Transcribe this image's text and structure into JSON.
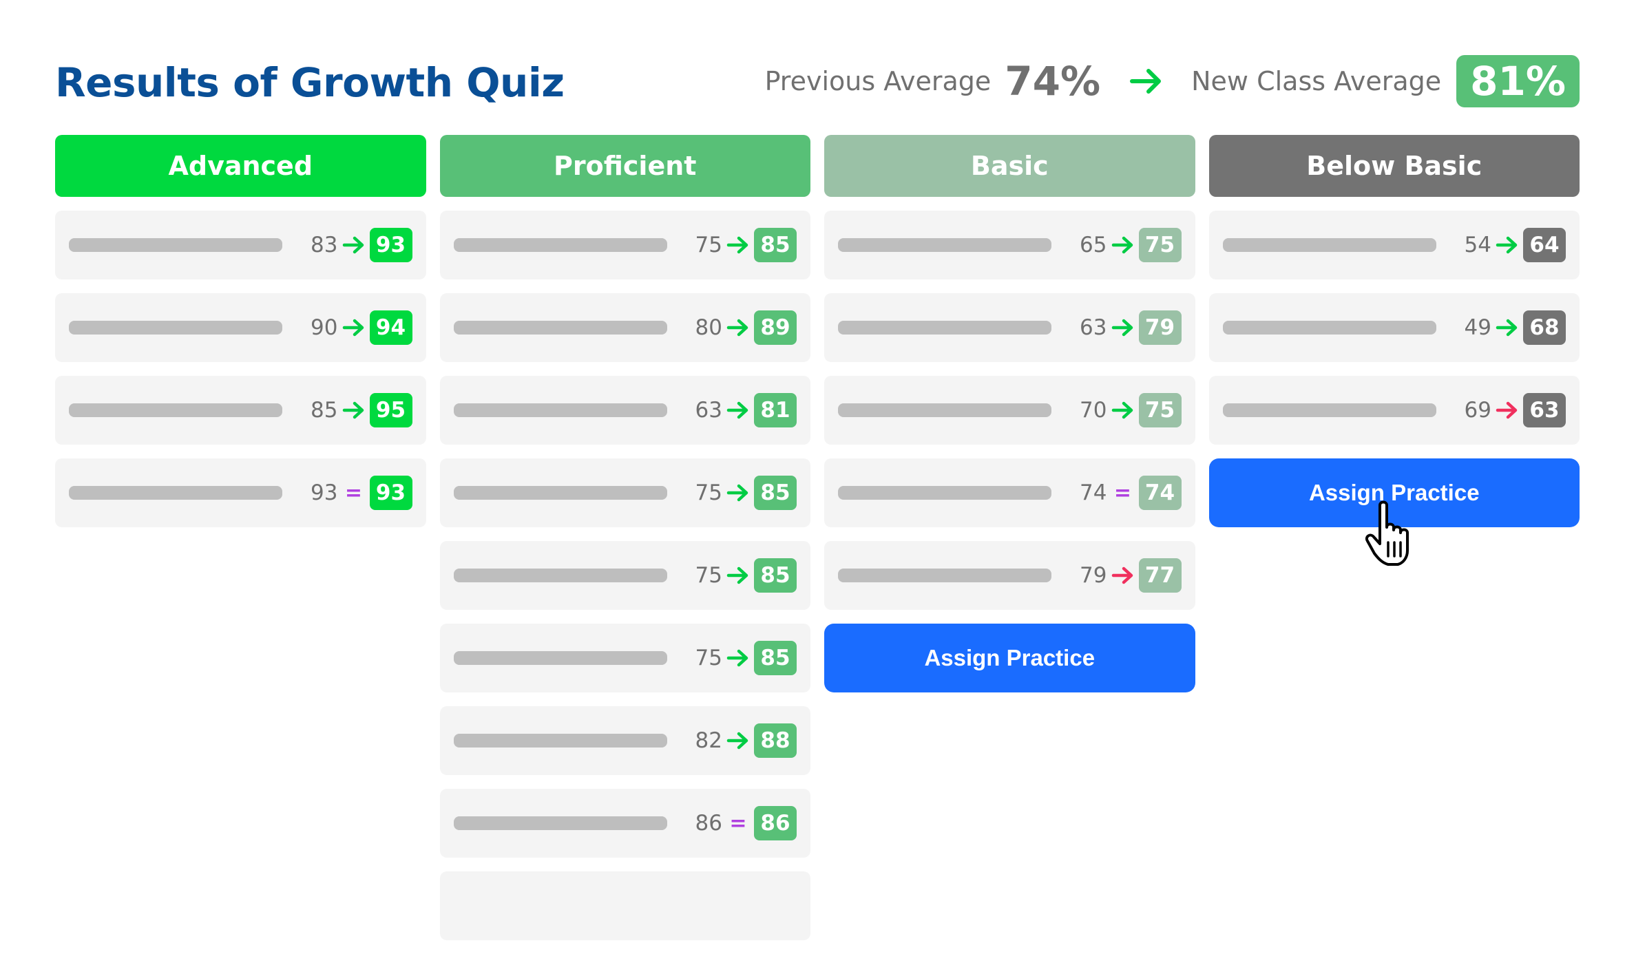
{
  "header": {
    "title": "Results of Growth Quiz",
    "previous_label": "Previous Average",
    "previous_value": "74%",
    "new_label": "New Class Average",
    "new_value": "81%",
    "new_badge_color": "#58c077",
    "arrow_icon": "arrow-right-icon"
  },
  "colors": {
    "increase": "#00cc44",
    "decrease": "#f0305e",
    "same": "#b040e0",
    "button": "#1a6cff"
  },
  "columns": [
    {
      "label": "Advanced",
      "color": "#00d93f",
      "students": [
        {
          "prev": "83",
          "change": "up",
          "new": "93"
        },
        {
          "prev": "90",
          "change": "up",
          "new": "94"
        },
        {
          "prev": "85",
          "change": "up",
          "new": "95"
        },
        {
          "prev": "93",
          "change": "same",
          "new": "93"
        }
      ]
    },
    {
      "label": "Proficient",
      "color": "#58c077",
      "students": [
        {
          "prev": "75",
          "change": "up",
          "new": "85"
        },
        {
          "prev": "80",
          "change": "up",
          "new": "89"
        },
        {
          "prev": "63",
          "change": "up",
          "new": "81"
        },
        {
          "prev": "75",
          "change": "up",
          "new": "85"
        },
        {
          "prev": "75",
          "change": "up",
          "new": "85"
        },
        {
          "prev": "75",
          "change": "up",
          "new": "85"
        },
        {
          "prev": "82",
          "change": "up",
          "new": "88"
        },
        {
          "prev": "86",
          "change": "same",
          "new": "86"
        },
        {
          "prev": "",
          "change": "",
          "new": ""
        }
      ]
    },
    {
      "label": "Basic",
      "color": "#9ac1a6",
      "students": [
        {
          "prev": "65",
          "change": "up",
          "new": "75"
        },
        {
          "prev": "63",
          "change": "up",
          "new": "79"
        },
        {
          "prev": "70",
          "change": "up",
          "new": "75"
        },
        {
          "prev": "74",
          "change": "same",
          "new": "74"
        },
        {
          "prev": "79",
          "change": "down",
          "new": "77"
        }
      ],
      "button": "Assign Practice"
    },
    {
      "label": "Below Basic",
      "color": "#737373",
      "students": [
        {
          "prev": "54",
          "change": "up",
          "new": "64"
        },
        {
          "prev": "49",
          "change": "up",
          "new": "68"
        },
        {
          "prev": "69",
          "change": "down",
          "new": "63"
        }
      ],
      "button": "Assign Practice"
    }
  ],
  "cursor": "hand-pointer-icon"
}
